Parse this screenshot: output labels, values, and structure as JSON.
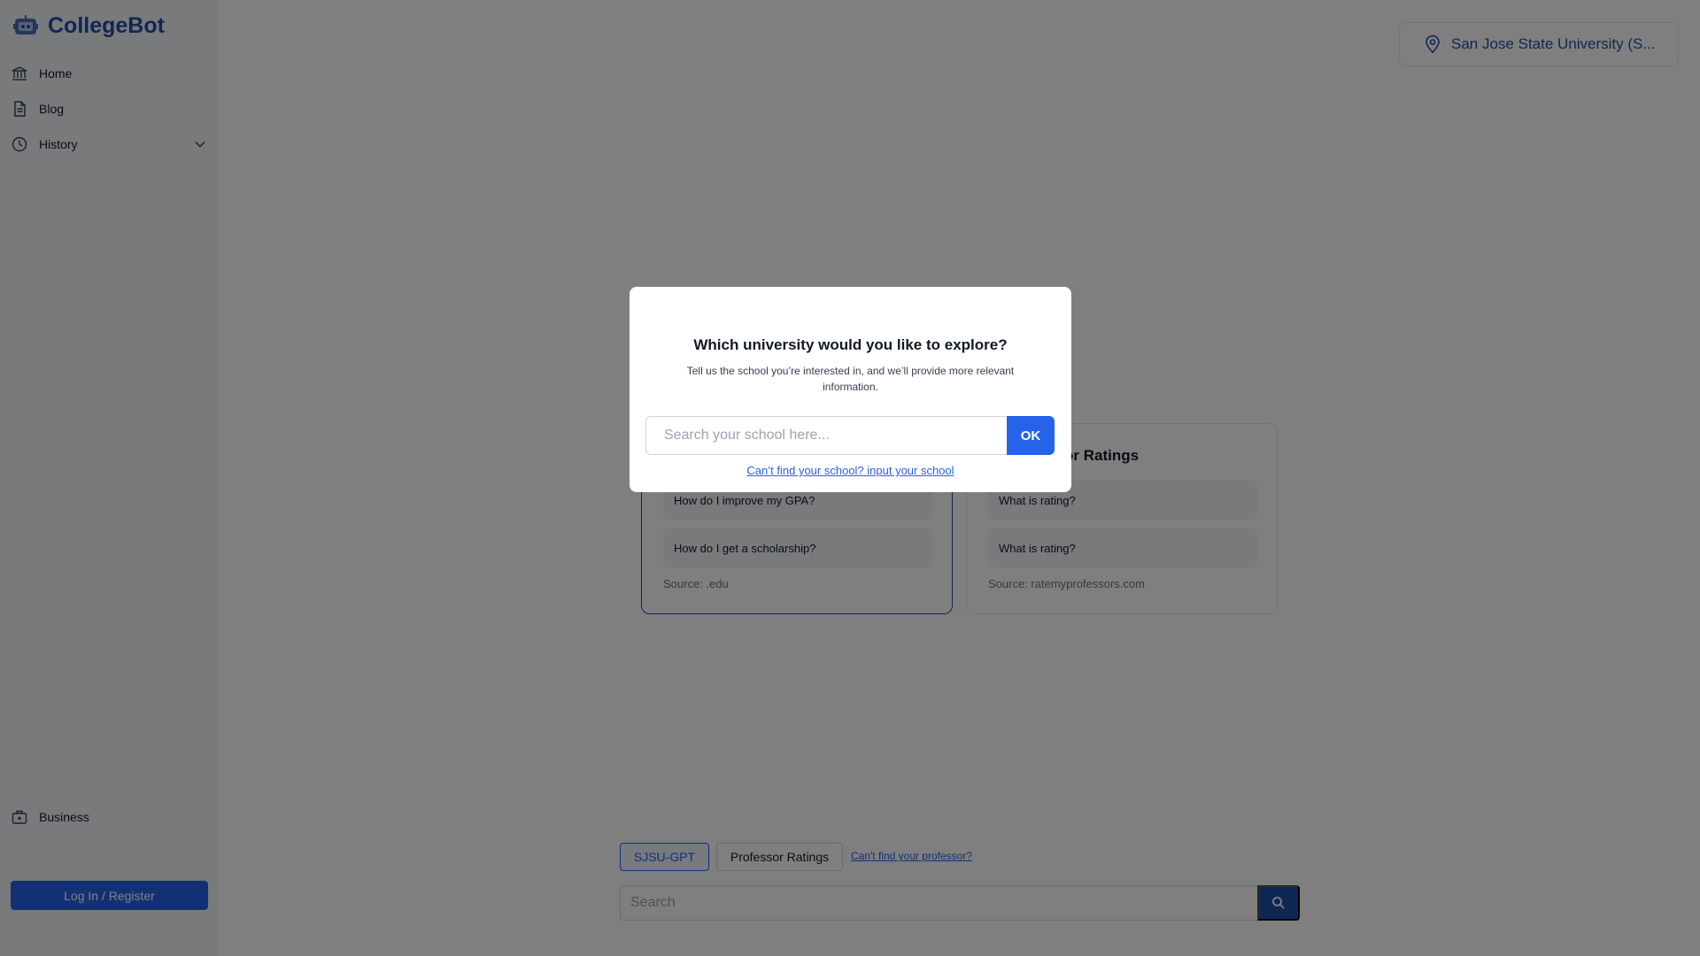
{
  "app": {
    "name": "CollegeBot"
  },
  "sidebar": {
    "items": [
      {
        "label": "Home",
        "icon": "bank-icon"
      },
      {
        "label": "Blog",
        "icon": "document-icon"
      },
      {
        "label": "History",
        "icon": "clock-icon"
      },
      {
        "label": "Business",
        "icon": "briefcase-icon"
      }
    ],
    "login_label": "Log In / Register"
  },
  "school_selector": {
    "label": "San Jose State University (S..."
  },
  "cards": [
    {
      "title": "",
      "questions": [
        "How do I improve my GPA?",
        "How do I get a scholarship?"
      ],
      "source": "Source: .edu"
    },
    {
      "title": "or Ratings",
      "questions": [
        "What is rating?",
        "What is rating?"
      ],
      "source": "Source: ratemyprofessors.com"
    }
  ],
  "bottom": {
    "tabs": [
      "SJSU-GPT",
      "Professor Ratings"
    ],
    "professor_link": "Can't find your professor?",
    "search_placeholder": "Search"
  },
  "modal": {
    "title": "Which university would you like to explore?",
    "subtitle": "Tell us the school you’re interested in, and we’ll provide more relevant information.",
    "input_placeholder": "Search your school here...",
    "ok_label": "OK",
    "link": "Can’t find your school? input your school"
  },
  "colors": {
    "brand": "#1e4fa8",
    "accent": "#2563eb",
    "overlay": "rgba(0,0,0,0.5)"
  }
}
